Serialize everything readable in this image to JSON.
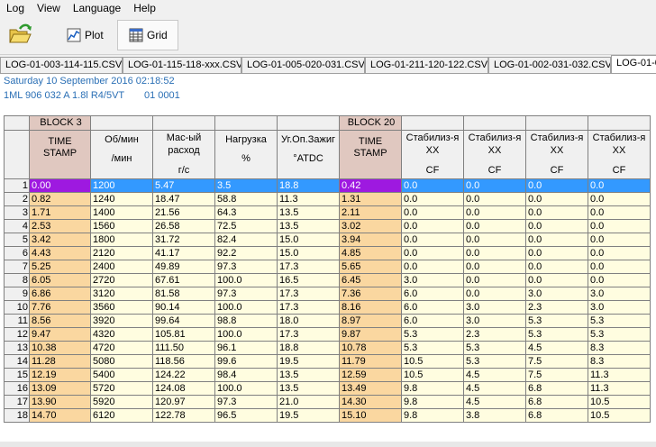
{
  "menu": [
    "Log",
    "View",
    "Language",
    "Help"
  ],
  "toolbar": {
    "open_icon": "folder-open-icon",
    "plot_label": "Plot",
    "grid_label": "Grid"
  },
  "tabs": [
    "LOG-01-003-114-115.CSV",
    "LOG-01-115-118-xxx.CSV",
    "LOG-01-005-020-031.CSV",
    "LOG-01-211-120-122.CSV",
    "LOG-01-002-031-032.CSV",
    "LOG-01-0"
  ],
  "active_tab": 5,
  "info": {
    "date": "Saturday 10 September 2016 02:18:52",
    "engine": "1ML 906 032 A  1.8l R4/5VT",
    "code": "01 0001"
  },
  "grid": {
    "group_headers": [
      "BLOCK 3",
      "",
      "",
      "",
      "",
      "BLOCK 20",
      "",
      "",
      "",
      ""
    ],
    "columns": [
      {
        "lines": [
          "TIME",
          "STAMP"
        ],
        "style": "ts"
      },
      {
        "lines": [
          "Об/мин",
          "/мин"
        ],
        "style": "two"
      },
      {
        "lines": [
          "Мас-ый",
          "расход",
          "г/с"
        ],
        "style": "three"
      },
      {
        "lines": [
          "Нагрузка",
          "%"
        ],
        "style": "two"
      },
      {
        "lines": [
          "Уг.Оп.Зажиг",
          "°ATDC"
        ],
        "style": "two"
      },
      {
        "lines": [
          "TIME",
          "STAMP"
        ],
        "style": "ts"
      },
      {
        "lines": [
          "Стабилиз-я",
          "XX",
          "CF"
        ],
        "style": "three"
      },
      {
        "lines": [
          "Стабилиз-я",
          "XX",
          "CF"
        ],
        "style": "three"
      },
      {
        "lines": [
          "Стабилиз-я",
          "XX",
          "CF"
        ],
        "style": "three"
      },
      {
        "lines": [
          "Стабилиз-я",
          "XX",
          "CF"
        ],
        "style": "three"
      }
    ],
    "selected_row": 0,
    "rows": [
      [
        "1",
        "0.00",
        "1200",
        "5.47",
        "3.5",
        "18.8",
        "0.42",
        "0.0",
        "0.0",
        "0.0",
        "0.0"
      ],
      [
        "2",
        "0.82",
        "1240",
        "18.47",
        "58.8",
        "11.3",
        "1.31",
        "0.0",
        "0.0",
        "0.0",
        "0.0"
      ],
      [
        "3",
        "1.71",
        "1400",
        "21.56",
        "64.3",
        "13.5",
        "2.11",
        "0.0",
        "0.0",
        "0.0",
        "0.0"
      ],
      [
        "4",
        "2.53",
        "1560",
        "26.58",
        "72.5",
        "13.5",
        "3.02",
        "0.0",
        "0.0",
        "0.0",
        "0.0"
      ],
      [
        "5",
        "3.42",
        "1800",
        "31.72",
        "82.4",
        "15.0",
        "3.94",
        "0.0",
        "0.0",
        "0.0",
        "0.0"
      ],
      [
        "6",
        "4.43",
        "2120",
        "41.17",
        "92.2",
        "15.0",
        "4.85",
        "0.0",
        "0.0",
        "0.0",
        "0.0"
      ],
      [
        "7",
        "5.25",
        "2400",
        "49.89",
        "97.3",
        "17.3",
        "5.65",
        "0.0",
        "0.0",
        "0.0",
        "0.0"
      ],
      [
        "8",
        "6.05",
        "2720",
        "67.61",
        "100.0",
        "16.5",
        "6.45",
        "3.0",
        "0.0",
        "0.0",
        "0.0"
      ],
      [
        "9",
        "6.86",
        "3120",
        "81.58",
        "97.3",
        "17.3",
        "7.36",
        "6.0",
        "0.0",
        "3.0",
        "3.0"
      ],
      [
        "10",
        "7.76",
        "3560",
        "90.14",
        "100.0",
        "17.3",
        "8.16",
        "6.0",
        "3.0",
        "2.3",
        "3.0"
      ],
      [
        "11",
        "8.56",
        "3920",
        "99.64",
        "98.8",
        "18.0",
        "8.97",
        "6.0",
        "3.0",
        "5.3",
        "5.3"
      ],
      [
        "12",
        "9.47",
        "4320",
        "105.81",
        "100.0",
        "17.3",
        "9.87",
        "5.3",
        "2.3",
        "5.3",
        "5.3"
      ],
      [
        "13",
        "10.38",
        "4720",
        "111.50",
        "96.1",
        "18.8",
        "10.78",
        "5.3",
        "5.3",
        "4.5",
        "8.3"
      ],
      [
        "14",
        "11.28",
        "5080",
        "118.56",
        "99.6",
        "19.5",
        "11.79",
        "10.5",
        "5.3",
        "7.5",
        "8.3"
      ],
      [
        "15",
        "12.19",
        "5400",
        "124.22",
        "98.4",
        "13.5",
        "12.59",
        "10.5",
        "4.5",
        "7.5",
        "11.3"
      ],
      [
        "16",
        "13.09",
        "5720",
        "124.08",
        "100.0",
        "13.5",
        "13.49",
        "9.8",
        "4.5",
        "6.8",
        "11.3"
      ],
      [
        "17",
        "13.90",
        "5920",
        "120.97",
        "97.3",
        "21.0",
        "14.30",
        "9.8",
        "4.5",
        "6.8",
        "10.5"
      ],
      [
        "18",
        "14.70",
        "6120",
        "122.78",
        "96.5",
        "19.5",
        "15.10",
        "9.8",
        "3.8",
        "6.8",
        "10.5"
      ]
    ]
  }
}
